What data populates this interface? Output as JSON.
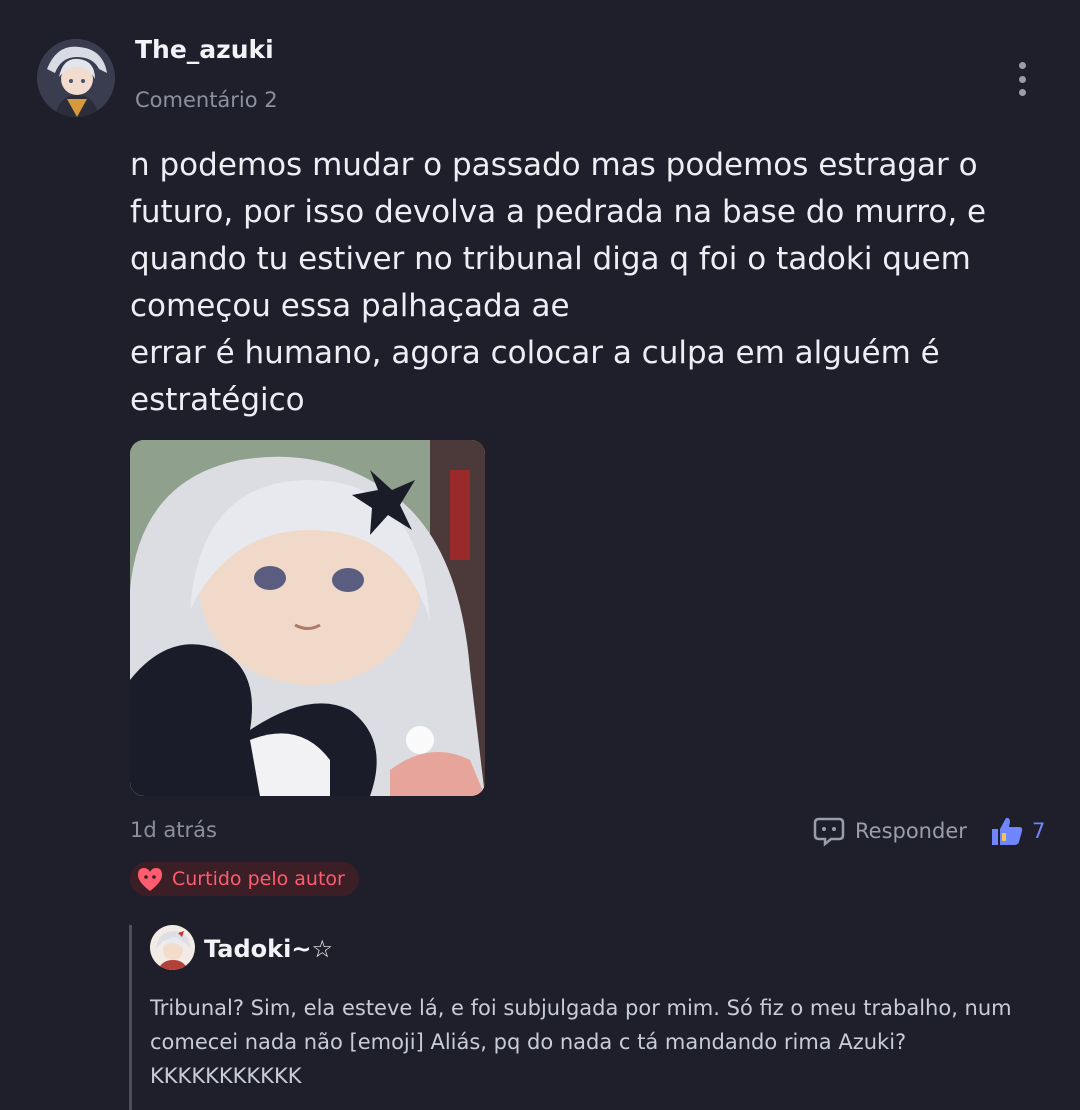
{
  "comment": {
    "author": "The_azuki",
    "subtitle": "Comentário 2",
    "lines": [
      "n podemos mudar o passado mas podemos estragar o futuro, por isso devolva a pedrada na base do murro, e quando tu estiver no tribunal diga q foi o tadoki quem começou essa palhaçada ae",
      "errar é humano, agora colocar a culpa em alguém é estratégico"
    ],
    "time": "1d atrás",
    "reply_label": "Responder",
    "like_count": "7",
    "author_liked_label": "Curtido pelo autor"
  },
  "reply": {
    "author": "Tadoki~☆",
    "text": "Tribunal? Sim, ela esteve lá, e foi subjulgada por mim. Só fiz o meu trabalho, num comecei nada não [emoji] Aliás, pq do nada c tá mandando rima Azuki? KKKKKKKKKKK"
  },
  "icons": {
    "more": "more-vertical-icon",
    "reply": "speech-bubble-icon",
    "like": "thumbs-up-icon",
    "badge": "heart-face-icon"
  },
  "colors": {
    "background": "#1e1f2b",
    "like_accent": "#6f86ff",
    "badge_text": "#ff5d6f",
    "badge_bg": "#3b1e26"
  }
}
